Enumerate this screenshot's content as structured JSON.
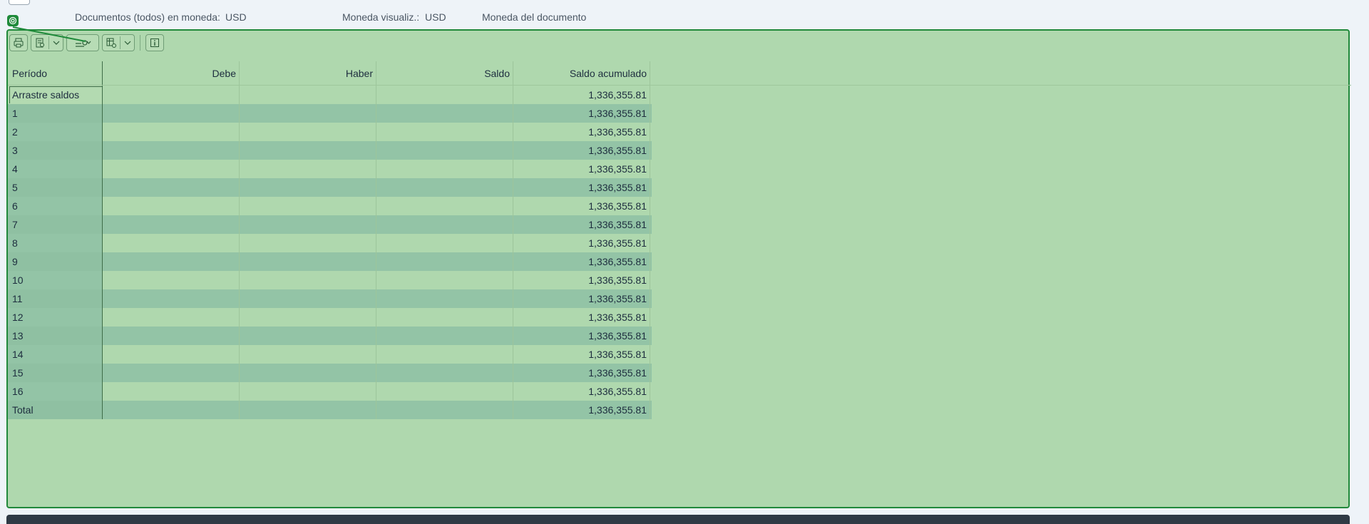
{
  "header": {
    "doc_currency_label": "Documentos (todos) en moneda:",
    "doc_currency_value": "USD",
    "display_currency_label": "Moneda visualiz.:",
    "display_currency_value": "USD",
    "document_currency": "Moneda del documento"
  },
  "toolbar": {
    "icons": [
      "print-icon",
      "view-icon",
      "dropdown-icon",
      "filter-icon",
      "layout-icon",
      "dropdown-icon",
      "info-icon"
    ]
  },
  "table": {
    "columns": [
      "Período",
      "Debe",
      "Haber",
      "Saldo",
      "Saldo acumulado"
    ],
    "rows": [
      {
        "period": "Arrastre saldos",
        "debit": "",
        "credit": "",
        "balance": "",
        "cumulative": "1,336,355.81"
      },
      {
        "period": "1",
        "debit": "",
        "credit": "",
        "balance": "",
        "cumulative": "1,336,355.81"
      },
      {
        "period": "2",
        "debit": "",
        "credit": "",
        "balance": "",
        "cumulative": "1,336,355.81"
      },
      {
        "period": "3",
        "debit": "",
        "credit": "",
        "balance": "",
        "cumulative": "1,336,355.81"
      },
      {
        "period": "4",
        "debit": "",
        "credit": "",
        "balance": "",
        "cumulative": "1,336,355.81"
      },
      {
        "period": "5",
        "debit": "",
        "credit": "",
        "balance": "",
        "cumulative": "1,336,355.81"
      },
      {
        "period": "6",
        "debit": "",
        "credit": "",
        "balance": "",
        "cumulative": "1,336,355.81"
      },
      {
        "period": "7",
        "debit": "",
        "credit": "",
        "balance": "",
        "cumulative": "1,336,355.81"
      },
      {
        "period": "8",
        "debit": "",
        "credit": "",
        "balance": "",
        "cumulative": "1,336,355.81"
      },
      {
        "period": "9",
        "debit": "",
        "credit": "",
        "balance": "",
        "cumulative": "1,336,355.81"
      },
      {
        "period": "10",
        "debit": "",
        "credit": "",
        "balance": "",
        "cumulative": "1,336,355.81"
      },
      {
        "period": "11",
        "debit": "",
        "credit": "",
        "balance": "",
        "cumulative": "1,336,355.81"
      },
      {
        "period": "12",
        "debit": "",
        "credit": "",
        "balance": "",
        "cumulative": "1,336,355.81"
      },
      {
        "period": "13",
        "debit": "",
        "credit": "",
        "balance": "",
        "cumulative": "1,336,355.81"
      },
      {
        "period": "14",
        "debit": "",
        "credit": "",
        "balance": "",
        "cumulative": "1,336,355.81"
      },
      {
        "period": "15",
        "debit": "",
        "credit": "",
        "balance": "",
        "cumulative": "1,336,355.81"
      },
      {
        "period": "16",
        "debit": "",
        "credit": "",
        "balance": "",
        "cumulative": "1,336,355.81"
      },
      {
        "period": "Total",
        "debit": "",
        "credit": "",
        "balance": "",
        "cumulative": "1,336,355.81"
      }
    ]
  },
  "colors": {
    "panel_bg": "#afd8ae",
    "panel_border": "#21893b",
    "row_alt": "#93c4a6"
  }
}
